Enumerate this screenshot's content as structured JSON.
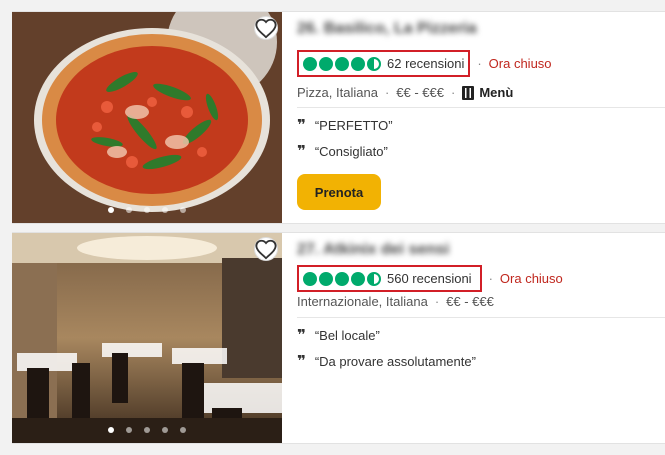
{
  "results": [
    {
      "title": "26. Basilico, La Pizzeria",
      "reviews": "62 recensioni",
      "status": "Ora chiuso",
      "cuisine": "Pizza, Italiana",
      "price": "€€ - €€€",
      "menu_label": "Menù",
      "quotes": [
        "“PERFETTO”",
        "“Consigliato”"
      ],
      "book_label": "Prenota"
    },
    {
      "title": "27. Atkinix dei sensi",
      "reviews": "560 recensioni",
      "status": "Ora chiuso",
      "cuisine": "Internazionale, Italiana",
      "price": "€€ - €€€",
      "quotes": [
        "“Bel locale”",
        "“Da provare assolutamente”"
      ]
    }
  ],
  "colors": {
    "bubble_green": "#00aa6c",
    "closed_red": "#c0271e",
    "highlight_box": "#d21f27",
    "book_button": "#f2b203"
  },
  "icons": [
    "heart-icon",
    "fork-knife-icon",
    "quote-icon"
  ]
}
